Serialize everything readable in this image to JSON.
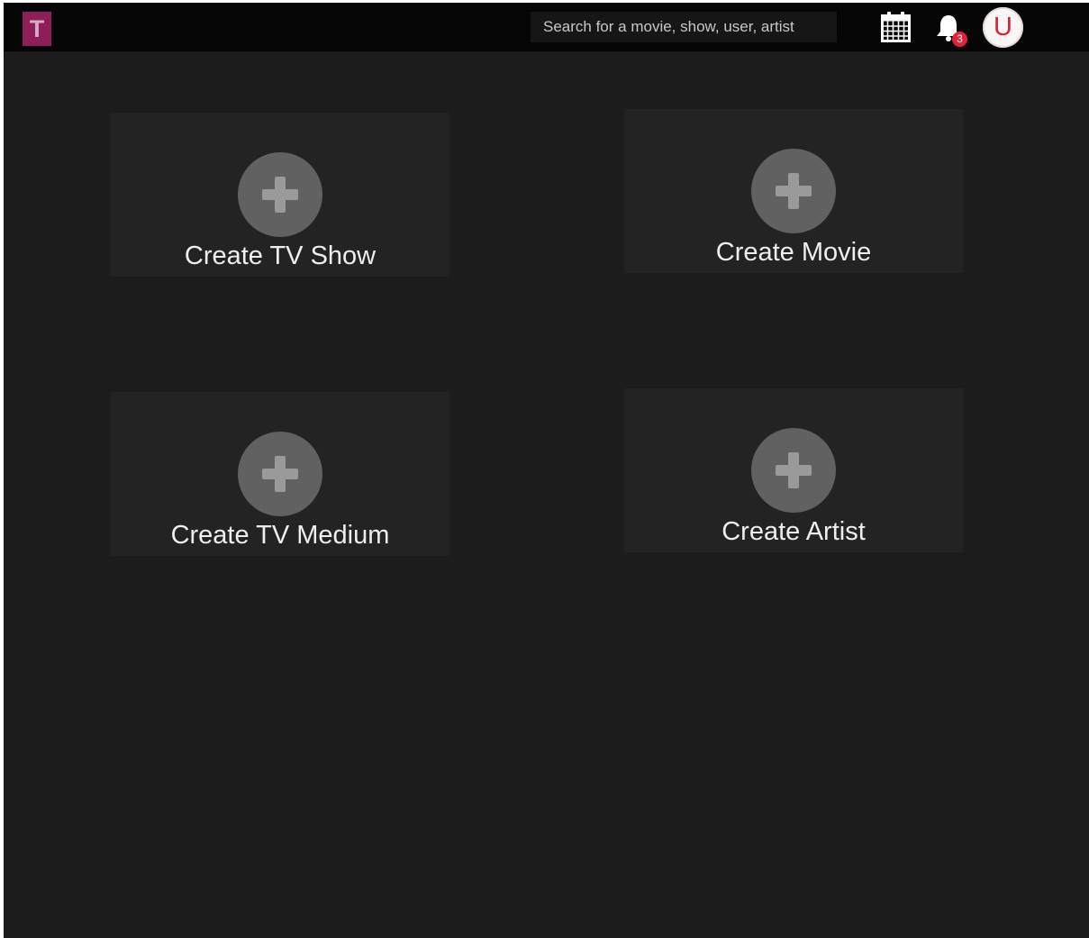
{
  "header": {
    "logo_letter": "T",
    "search_placeholder": "Search for a movie, show, user, artist",
    "calendar_icon": "calendar-icon",
    "notifications": {
      "icon": "bell-icon",
      "badge_count": "3",
      "badge_color": "#e0233a"
    },
    "avatar_letter": "U"
  },
  "cards": [
    {
      "label": "Create TV Show",
      "icon": "plus-circle-icon"
    },
    {
      "label": "Create Movie",
      "icon": "plus-circle-icon"
    },
    {
      "label": "Create TV Medium",
      "icon": "plus-circle-icon"
    },
    {
      "label": "Create Artist",
      "icon": "plus-circle-icon"
    }
  ],
  "colors": {
    "background": "#1c1c1c",
    "topbar": "#050505",
    "card": "#232323",
    "logo": "#8e1e58",
    "avatar_letter": "#d6242f"
  }
}
